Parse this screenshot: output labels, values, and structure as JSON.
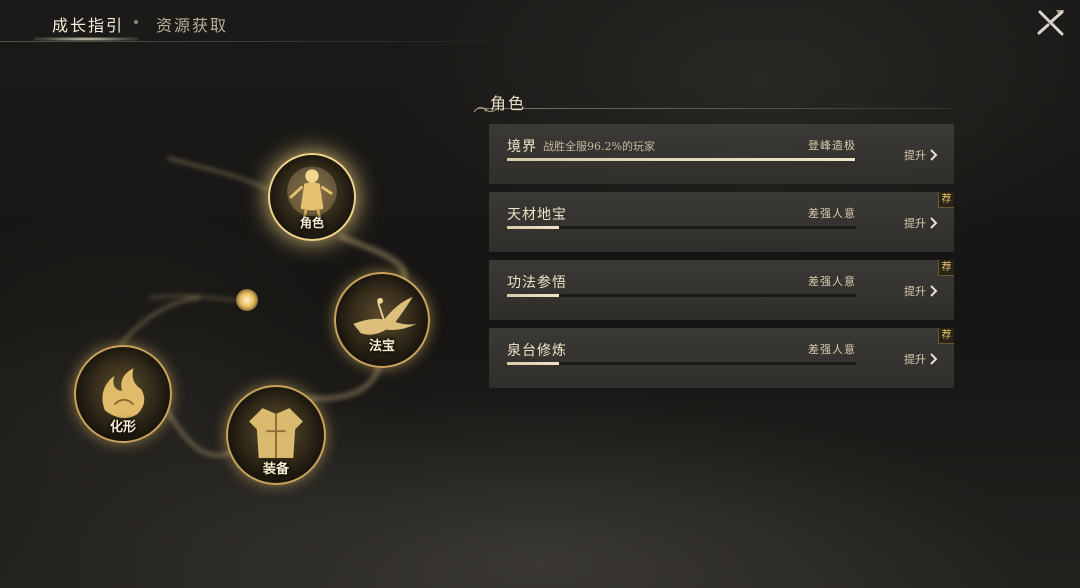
{
  "tabs": {
    "active": "成长指引",
    "inactive": "资源获取"
  },
  "nodes": [
    {
      "key": "role",
      "label": "角色"
    },
    {
      "key": "fabao",
      "label": "法宝"
    },
    {
      "key": "equip",
      "label": "装备"
    },
    {
      "key": "huaxing",
      "label": "化形"
    }
  ],
  "section": {
    "title": "角色"
  },
  "cards": [
    {
      "name": "境界",
      "subtitle": "战胜全服96.2%的玩家",
      "grade": "登峰造极",
      "progress": 0.996,
      "button": "提升",
      "badge": ""
    },
    {
      "name": "天材地宝",
      "subtitle": "",
      "grade": "差强人意",
      "progress": 0.15,
      "button": "提升",
      "badge": "荐"
    },
    {
      "name": "功法参悟",
      "subtitle": "",
      "grade": "差强人意",
      "progress": 0.15,
      "button": "提升",
      "badge": "荐"
    },
    {
      "name": "泉台修炼",
      "subtitle": "",
      "grade": "差强人意",
      "progress": 0.15,
      "button": "提升",
      "badge": "荐"
    }
  ],
  "colors": {
    "accent_gold": "#e8c46e",
    "panel_bg": "#3e3c38",
    "text_light": "#efe4c8"
  },
  "icons": {
    "close": "close-x-icon",
    "chevron": "chevron-right-icon"
  }
}
